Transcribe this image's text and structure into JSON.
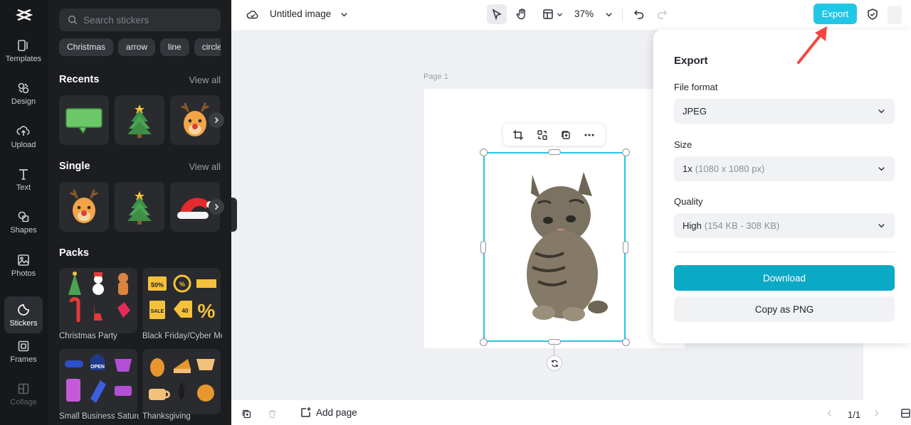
{
  "app": {
    "doc_title": "Untitled image",
    "zoom": "37%",
    "export_label": "Export"
  },
  "rail": {
    "items": [
      {
        "label": "Templates",
        "icon": "templates-icon"
      },
      {
        "label": "Design",
        "icon": "design-icon"
      },
      {
        "label": "Upload",
        "icon": "upload-icon"
      },
      {
        "label": "Text",
        "icon": "text-icon"
      },
      {
        "label": "Shapes",
        "icon": "shapes-icon"
      },
      {
        "label": "Photos",
        "icon": "photos-icon"
      },
      {
        "label": "Stickers",
        "icon": "stickers-icon"
      },
      {
        "label": "Frames",
        "icon": "frames-icon"
      },
      {
        "label": "Collage",
        "icon": "collage-icon"
      }
    ]
  },
  "panel": {
    "search_placeholder": "Search stickers",
    "chips": [
      "Christmas",
      "arrow",
      "line",
      "circle"
    ],
    "recents_title": "Recents",
    "single_title": "Single",
    "packs_title": "Packs",
    "view_all": "View all",
    "packs": [
      "Christmas Party",
      "Black Friday/Cyber Monday",
      "Small Business Saturday",
      "Thanksgiving"
    ]
  },
  "canvas": {
    "page_label": "Page 1"
  },
  "export_panel": {
    "title": "Export",
    "file_format_label": "File format",
    "file_format_value": "JPEG",
    "size_label": "Size",
    "size_value": "1x",
    "size_detail": "(1080 x 1080 px)",
    "quality_label": "Quality",
    "quality_value": "High",
    "quality_detail": "(154 KB - 308 KB)",
    "download_label": "Download",
    "copy_label": "Copy as PNG"
  },
  "bottom": {
    "add_page_label": "Add page",
    "pager": "1/1"
  },
  "colors": {
    "accent": "#22c7e6",
    "download": "#0aa9c6",
    "rail_bg": "#17181a",
    "panel_bg": "#1c1d20",
    "annotation_arrow": "#f0483e"
  }
}
